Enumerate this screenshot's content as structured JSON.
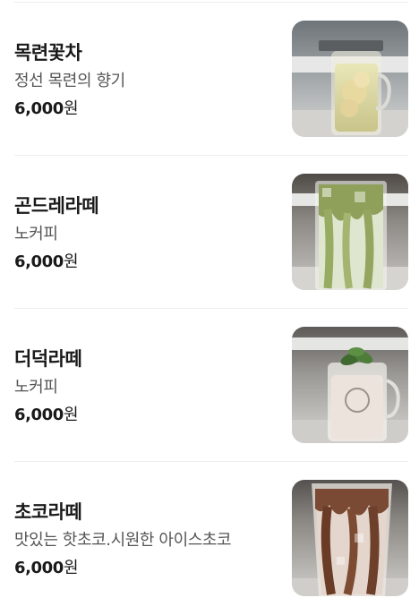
{
  "menu": {
    "items": [
      {
        "name": "목련꽃차",
        "description": "정선 목련의 향기",
        "price": "6,000",
        "currency": "원",
        "image": "magnolia-tea-photo"
      },
      {
        "name": "곤드레라떼",
        "description": "노커피",
        "price": "6,000",
        "currency": "원",
        "image": "gondre-latte-photo"
      },
      {
        "name": "더덕라떼",
        "description": "노커피",
        "price": "6,000",
        "currency": "원",
        "image": "deodeok-latte-photo"
      },
      {
        "name": "초코라떼",
        "description": "맛있는 핫초코.시원한 아이스초코",
        "price": "6,000",
        "currency": "원",
        "image": "choco-latte-photo"
      }
    ]
  }
}
